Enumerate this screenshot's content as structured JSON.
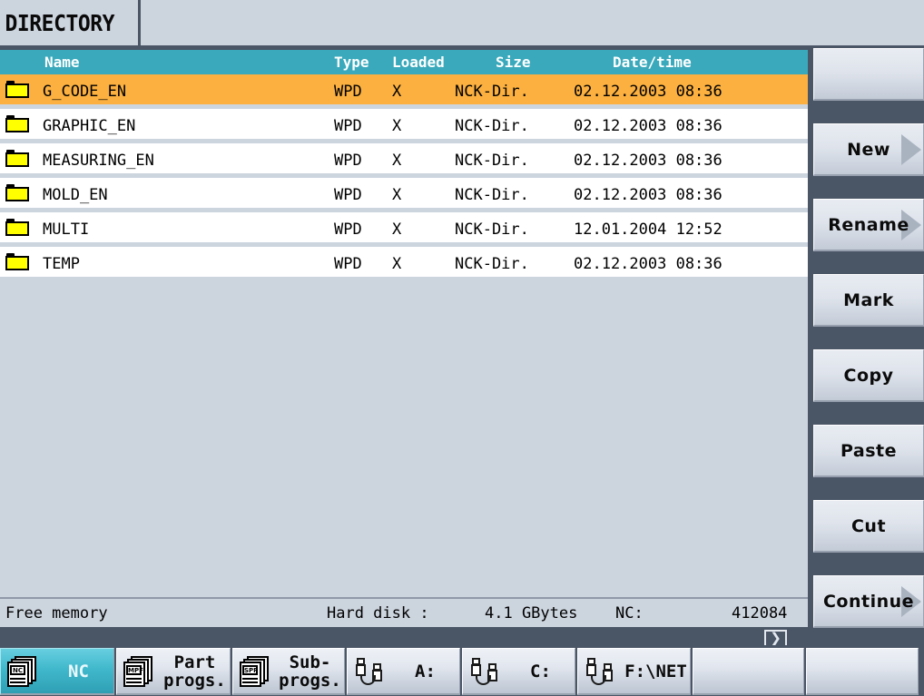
{
  "window": {
    "title": "DIRECTORY"
  },
  "table": {
    "columns": [
      "Name",
      "Type",
      "Loaded",
      "Size",
      "Date/time"
    ],
    "rows": [
      {
        "icon": "folder-icon",
        "name": "G_CODE_EN",
        "type": "WPD",
        "loaded": "X",
        "size": "NCK-Dir.",
        "date": "02.12.2003 08:36",
        "selected": true
      },
      {
        "icon": "folder-icon",
        "name": "GRAPHIC_EN",
        "type": "WPD",
        "loaded": "X",
        "size": "NCK-Dir.",
        "date": "02.12.2003 08:36",
        "selected": false
      },
      {
        "icon": "folder-icon",
        "name": "MEASURING_EN",
        "type": "WPD",
        "loaded": "X",
        "size": "NCK-Dir.",
        "date": "02.12.2003 08:36",
        "selected": false
      },
      {
        "icon": "folder-icon",
        "name": "MOLD_EN",
        "type": "WPD",
        "loaded": "X",
        "size": "NCK-Dir.",
        "date": "02.12.2003 08:36",
        "selected": false
      },
      {
        "icon": "folder-icon",
        "name": "MULTI",
        "type": "WPD",
        "loaded": "X",
        "size": "NCK-Dir.",
        "date": "12.01.2004 12:52",
        "selected": false
      },
      {
        "icon": "folder-icon",
        "name": "TEMP",
        "type": "WPD",
        "loaded": "X",
        "size": "NCK-Dir.",
        "date": "02.12.2003 08:36",
        "selected": false
      }
    ]
  },
  "status": {
    "free_memory_label": "Free memory",
    "hard_disk_label": "Hard disk :",
    "hard_disk_value": "4.1 GBytes",
    "nc_label": "NC:",
    "nc_value": "412084"
  },
  "scroll": {
    "next_page_icon": "chevron-right-icon"
  },
  "softkeys": [
    {
      "label": "",
      "arrow": false
    },
    {
      "label": "New",
      "arrow": true
    },
    {
      "label": "Rename",
      "arrow": true
    },
    {
      "label": "Mark",
      "arrow": false
    },
    {
      "label": "Copy",
      "arrow": false
    },
    {
      "label": "Paste",
      "arrow": false
    },
    {
      "label": "Cut",
      "arrow": false
    },
    {
      "label": "Continue",
      "arrow": true
    }
  ],
  "taskbar": [
    {
      "label": "NC",
      "icon": "nc-document-stack-icon",
      "tag": "NC",
      "active": true
    },
    {
      "label": "Part\nprogs.",
      "icon": "mpf-document-stack-icon",
      "tag": "MPF",
      "active": false
    },
    {
      "label": "Sub-\nprogs.",
      "icon": "spf-document-stack-icon",
      "tag": "SPF",
      "active": false
    },
    {
      "label": "A:",
      "icon": "drive-plug-icon",
      "tag": "",
      "active": false
    },
    {
      "label": "C:",
      "icon": "drive-plug-icon",
      "tag": "",
      "active": false
    },
    {
      "label": "F:\\NET",
      "icon": "drive-plug-icon",
      "tag": "",
      "active": false
    },
    {
      "label": "",
      "icon": "",
      "tag": "",
      "active": false
    },
    {
      "label": "",
      "icon": "",
      "tag": "",
      "active": false
    }
  ],
  "colors": {
    "header_teal": "#39a9bb",
    "selection_orange": "#fbb040",
    "panel_gray": "#ccd4de",
    "chrome_slate": "#4a5566",
    "folder_yellow": "#ffff00"
  }
}
